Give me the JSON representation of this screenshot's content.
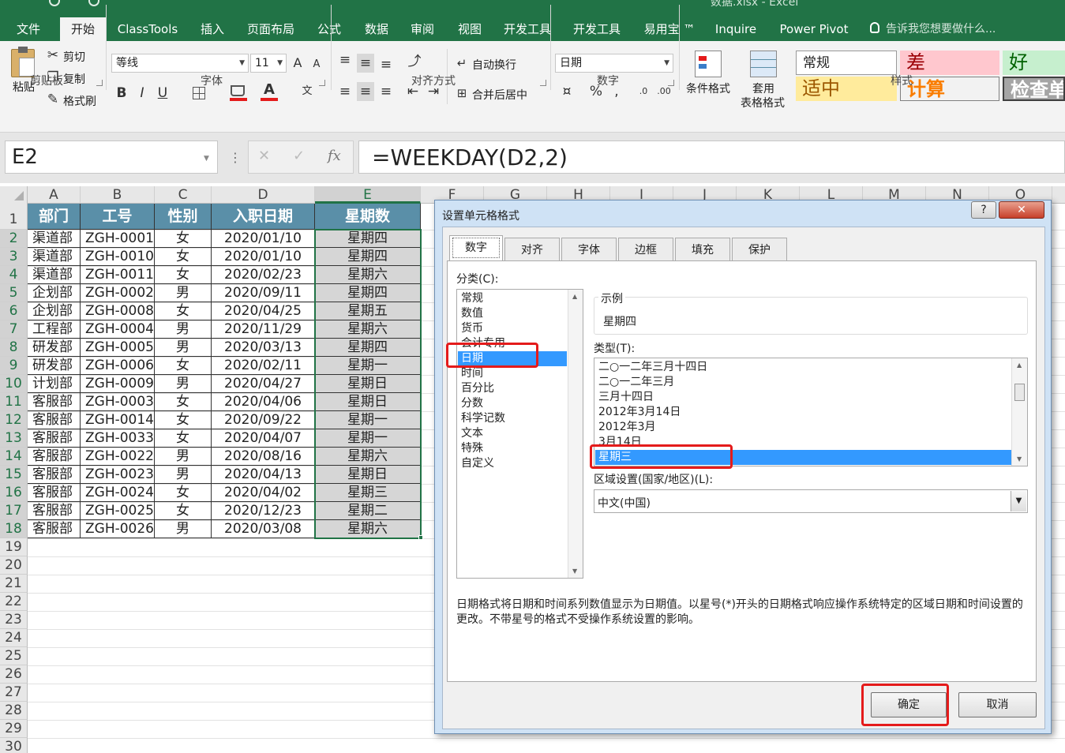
{
  "title": {
    "text": "数据.xlsx - Excel"
  },
  "menu": [
    "文件",
    "开始",
    "ClassTools",
    "插入",
    "页面布局",
    "公式",
    "数据",
    "审阅",
    "视图",
    "开发工具",
    "开发工具",
    "易用宝 ™",
    "Inquire",
    "Power Pivot",
    "告诉我您想要做什么..."
  ],
  "ribbon": {
    "clipboard": {
      "paste": "粘贴",
      "cut": "剪切",
      "copy": "复制",
      "format_painter": "格式刷",
      "label": "剪贴板"
    },
    "font": {
      "name": "等线",
      "size": "11",
      "label": "字体",
      "bold": "B",
      "italic": "I",
      "underline": "U"
    },
    "alignment": {
      "wrap": "自动换行",
      "merge": "合并后居中",
      "label": "对齐方式"
    },
    "number": {
      "format": "日期",
      "label": "数字"
    },
    "styles": {
      "conditional": "条件格式",
      "table1": "套用",
      "table2": "表格格式",
      "label": "样式",
      "normal": "常规",
      "bad": "差",
      "good": "好",
      "neutral": "适中",
      "calculation": "计算",
      "check": "检查单"
    }
  },
  "formula_bar": {
    "name_box": "E2",
    "formula": "=WEEKDAY(D2,2)",
    "fx": "fx"
  },
  "columns": [
    "A",
    "B",
    "C",
    "D",
    "E",
    "F",
    "G",
    "H",
    "I",
    "J",
    "K",
    "L",
    "M",
    "N",
    "O"
  ],
  "rows": [
    "1",
    "2",
    "3",
    "4",
    "5",
    "6",
    "7",
    "8",
    "9",
    "10",
    "11",
    "12",
    "13",
    "14",
    "15",
    "16",
    "17",
    "18",
    "19",
    "20",
    "21",
    "22",
    "23",
    "24",
    "25",
    "26",
    "27",
    "28",
    "29",
    "30"
  ],
  "table": {
    "headers": [
      "部门",
      "工号",
      "性别",
      "入职日期",
      "星期数"
    ],
    "rows": [
      [
        "渠道部",
        "ZGH-0001",
        "女",
        "2020/01/10",
        "星期四"
      ],
      [
        "渠道部",
        "ZGH-0010",
        "女",
        "2020/01/10",
        "星期四"
      ],
      [
        "渠道部",
        "ZGH-0011",
        "女",
        "2020/02/23",
        "星期六"
      ],
      [
        "企划部",
        "ZGH-0002",
        "男",
        "2020/09/11",
        "星期四"
      ],
      [
        "企划部",
        "ZGH-0008",
        "女",
        "2020/04/25",
        "星期五"
      ],
      [
        "工程部",
        "ZGH-0004",
        "男",
        "2020/11/29",
        "星期六"
      ],
      [
        "研发部",
        "ZGH-0005",
        "男",
        "2020/03/13",
        "星期四"
      ],
      [
        "研发部",
        "ZGH-0006",
        "女",
        "2020/02/11",
        "星期一"
      ],
      [
        "计划部",
        "ZGH-0009",
        "男",
        "2020/04/27",
        "星期日"
      ],
      [
        "客服部",
        "ZGH-0003",
        "女",
        "2020/04/06",
        "星期日"
      ],
      [
        "客服部",
        "ZGH-0014",
        "女",
        "2020/09/22",
        "星期一"
      ],
      [
        "客服部",
        "ZGH-0033",
        "女",
        "2020/04/07",
        "星期一"
      ],
      [
        "客服部",
        "ZGH-0022",
        "男",
        "2020/08/16",
        "星期六"
      ],
      [
        "客服部",
        "ZGH-0023",
        "男",
        "2020/04/13",
        "星期日"
      ],
      [
        "客服部",
        "ZGH-0024",
        "女",
        "2020/04/02",
        "星期三"
      ],
      [
        "客服部",
        "ZGH-0025",
        "女",
        "2020/12/23",
        "星期二"
      ],
      [
        "客服部",
        "ZGH-0026",
        "男",
        "2020/03/08",
        "星期六"
      ]
    ]
  },
  "dialog": {
    "title": "设置单元格格式",
    "help": "?",
    "close": "✕",
    "tabs": [
      "数字",
      "对齐",
      "字体",
      "边框",
      "填充",
      "保护"
    ],
    "category_label": "分类(C):",
    "categories": [
      "常规",
      "数值",
      "货币",
      "会计专用",
      "日期",
      "时间",
      "百分比",
      "分数",
      "科学记数",
      "文本",
      "特殊",
      "自定义"
    ],
    "selected_category": "日期",
    "sample_label": "示例",
    "sample_value": "星期四",
    "type_label": "类型(T):",
    "types": [
      "二○一二年三月十四日",
      "二○一二年三月",
      "三月十四日",
      "2012年3月14日",
      "2012年3月",
      "3月14日",
      "星期三"
    ],
    "selected_type": "星期三",
    "locale_label": "区域设置(国家/地区)(L):",
    "locale_value": "中文(中国)",
    "description": "日期格式将日期和时间系列数值显示为日期值。以星号(*)开头的日期格式响应操作系统特定的区域日期和时间设置的更改。不带星号的格式不受操作系统设置的影响。",
    "ok": "确定",
    "cancel": "取消"
  },
  "colors": {
    "excel_green": "#217346",
    "header_fill": "#5a8fa8",
    "highlight": "#e41b1b",
    "selection": "#3399ff"
  }
}
